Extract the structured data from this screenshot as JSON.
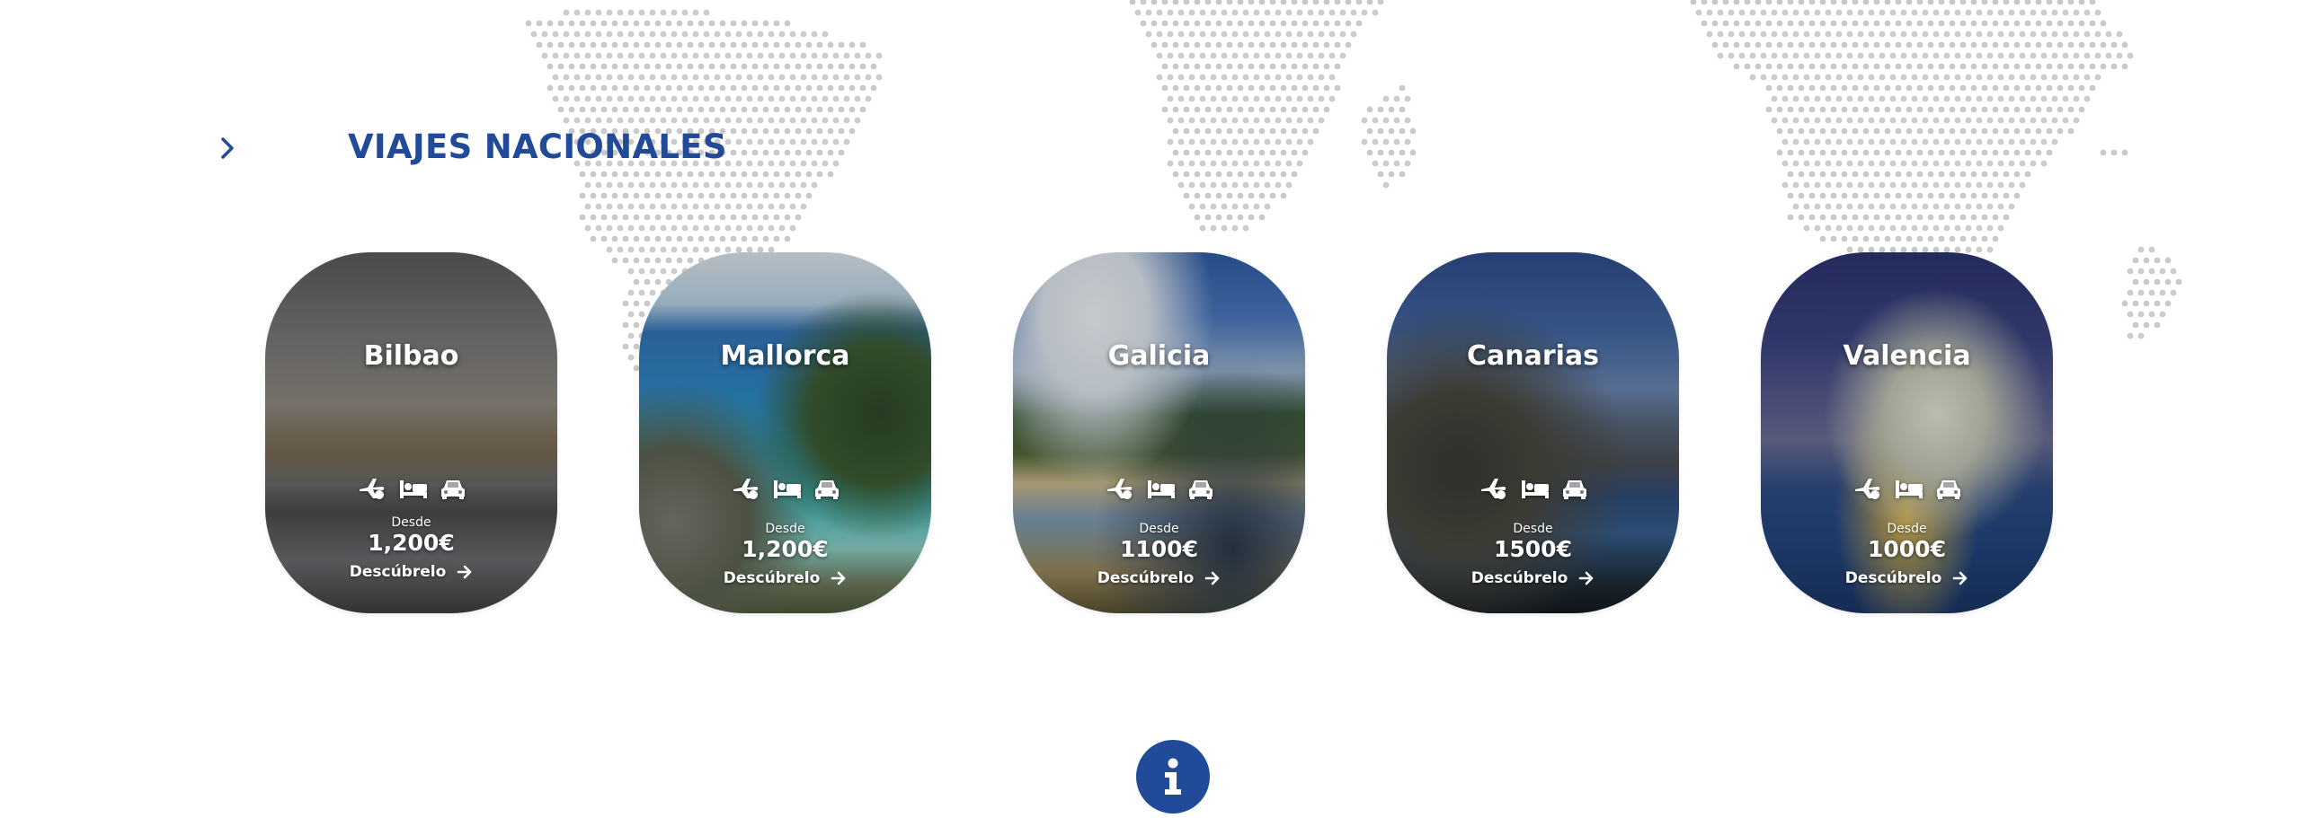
{
  "section": {
    "title": "VIAJES NACIONALES",
    "title_color": "#214a98"
  },
  "cards": [
    {
      "city": "Bilbao",
      "desde": "Desde",
      "price": "1,200€",
      "cta": "Descúbrelo"
    },
    {
      "city": "Mallorca",
      "desde": "Desde",
      "price": "1,200€",
      "cta": "Descúbrelo"
    },
    {
      "city": "Galicia",
      "desde": "Desde",
      "price": "1100€",
      "cta": "Descúbrelo"
    },
    {
      "city": "Canarias",
      "desde": "Desde",
      "price": "1500€",
      "cta": "Descúbrelo"
    },
    {
      "city": "Valencia",
      "desde": "Desde",
      "price": "1000€",
      "cta": "Descúbrelo"
    }
  ],
  "icons": {
    "section_chevron": "chevron-right-icon",
    "services": [
      "plane-icon",
      "bed-icon",
      "car-icon"
    ],
    "cta_arrow": "arrow-right-icon",
    "info": "info-icon"
  },
  "colors": {
    "accent": "#214a98",
    "map_dots": "#c9c9c9"
  }
}
